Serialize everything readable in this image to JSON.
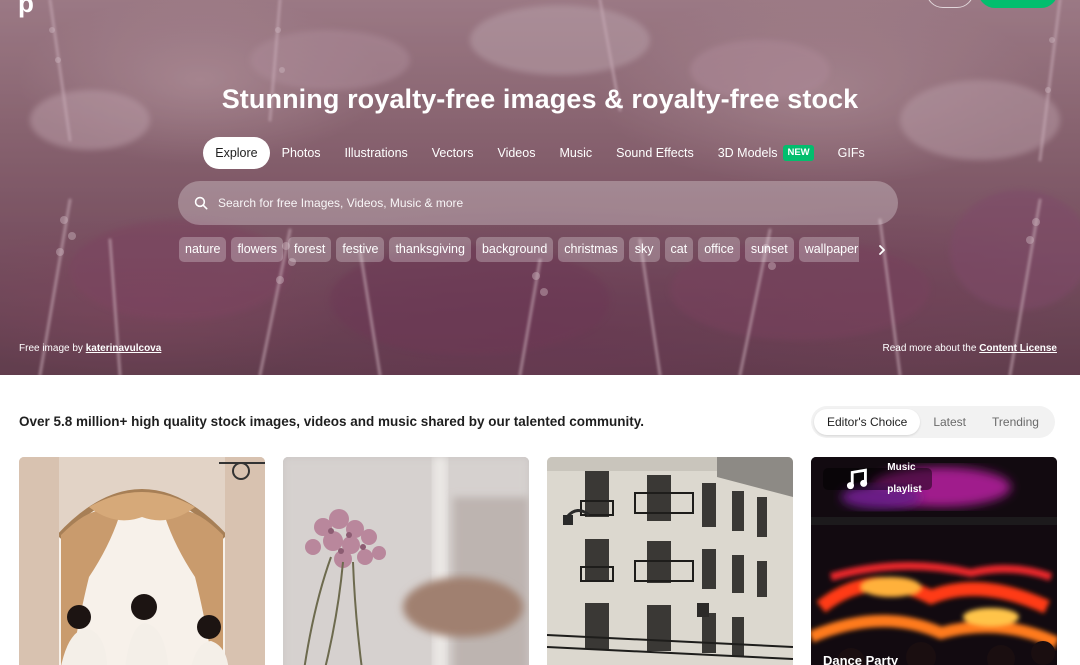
{
  "header": {
    "logo_text": "p",
    "login_label": "",
    "join_label": "",
    "join_color": "#02be6e"
  },
  "hero": {
    "title": "Stunning royalty-free images & royalty-free stock",
    "tabs": [
      {
        "label": "Explore",
        "active": true
      },
      {
        "label": "Photos"
      },
      {
        "label": "Illustrations"
      },
      {
        "label": "Vectors"
      },
      {
        "label": "Videos"
      },
      {
        "label": "Music"
      },
      {
        "label": "Sound Effects"
      },
      {
        "label": "3D Models",
        "badge": "NEW"
      },
      {
        "label": "GIFs"
      }
    ],
    "search": {
      "placeholder": "Search for free Images, Videos, Music & more",
      "value": "",
      "icon": "search-icon"
    },
    "chips": [
      "nature",
      "flowers",
      "forest",
      "festive",
      "thanksgiving",
      "background",
      "christmas",
      "sky",
      "cat",
      "office",
      "sunset",
      "wallpaper"
    ],
    "chips_next_icon": "chevron-right-icon",
    "credit_prefix": "Free image by ",
    "credit_author": "katerinavulcova",
    "license_prefix": "Read more about the ",
    "license_link": "Content License"
  },
  "main": {
    "intro": "Over 5.8 million+ high quality stock images, videos and music shared by our talented community.",
    "sort": [
      {
        "label": "Editor's Choice",
        "active": true
      },
      {
        "label": "Latest"
      },
      {
        "label": "Trending"
      }
    ],
    "cards": [
      {
        "kind": "image",
        "description": "women-by-arched-window"
      },
      {
        "kind": "image",
        "description": "dried-flowers-by-window"
      },
      {
        "kind": "image",
        "description": "parisian-building-facade"
      },
      {
        "kind": "playlist",
        "badge": "Music playlist",
        "badge_icon": "music-note-icon",
        "title": "Dance Party"
      }
    ]
  },
  "colors": {
    "accent": "#02be6e",
    "text": "#1f1f1f",
    "muted": "#6a6a6a"
  }
}
